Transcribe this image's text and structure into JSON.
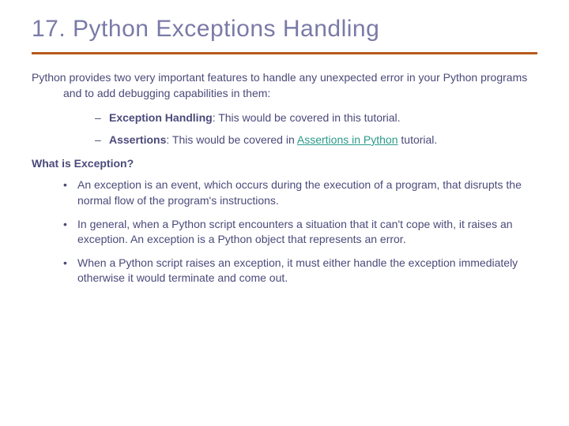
{
  "title": "17. Python Exceptions Handling",
  "intro": "Python provides two very important features to handle any unexpected error in your Python programs and to add debugging capabilities in them:",
  "sub_items": [
    {
      "bold": "Exception Handling",
      "rest": ": This would be covered in this tutorial."
    },
    {
      "bold": "Assertions",
      "rest_before": ": This would be covered in ",
      "link": "Assertions in Python",
      "rest_after": " tutorial."
    }
  ],
  "heading": "What is Exception?",
  "bullets": [
    "An exception is an event, which occurs during the execution of a program, that disrupts the normal flow of the program's instructions.",
    "In general, when a Python script encounters a situation that it can't cope with, it raises an exception. An exception is a Python object that represents an error.",
    "When a Python script raises an exception, it must either handle the exception immediately otherwise it would terminate and come out."
  ]
}
